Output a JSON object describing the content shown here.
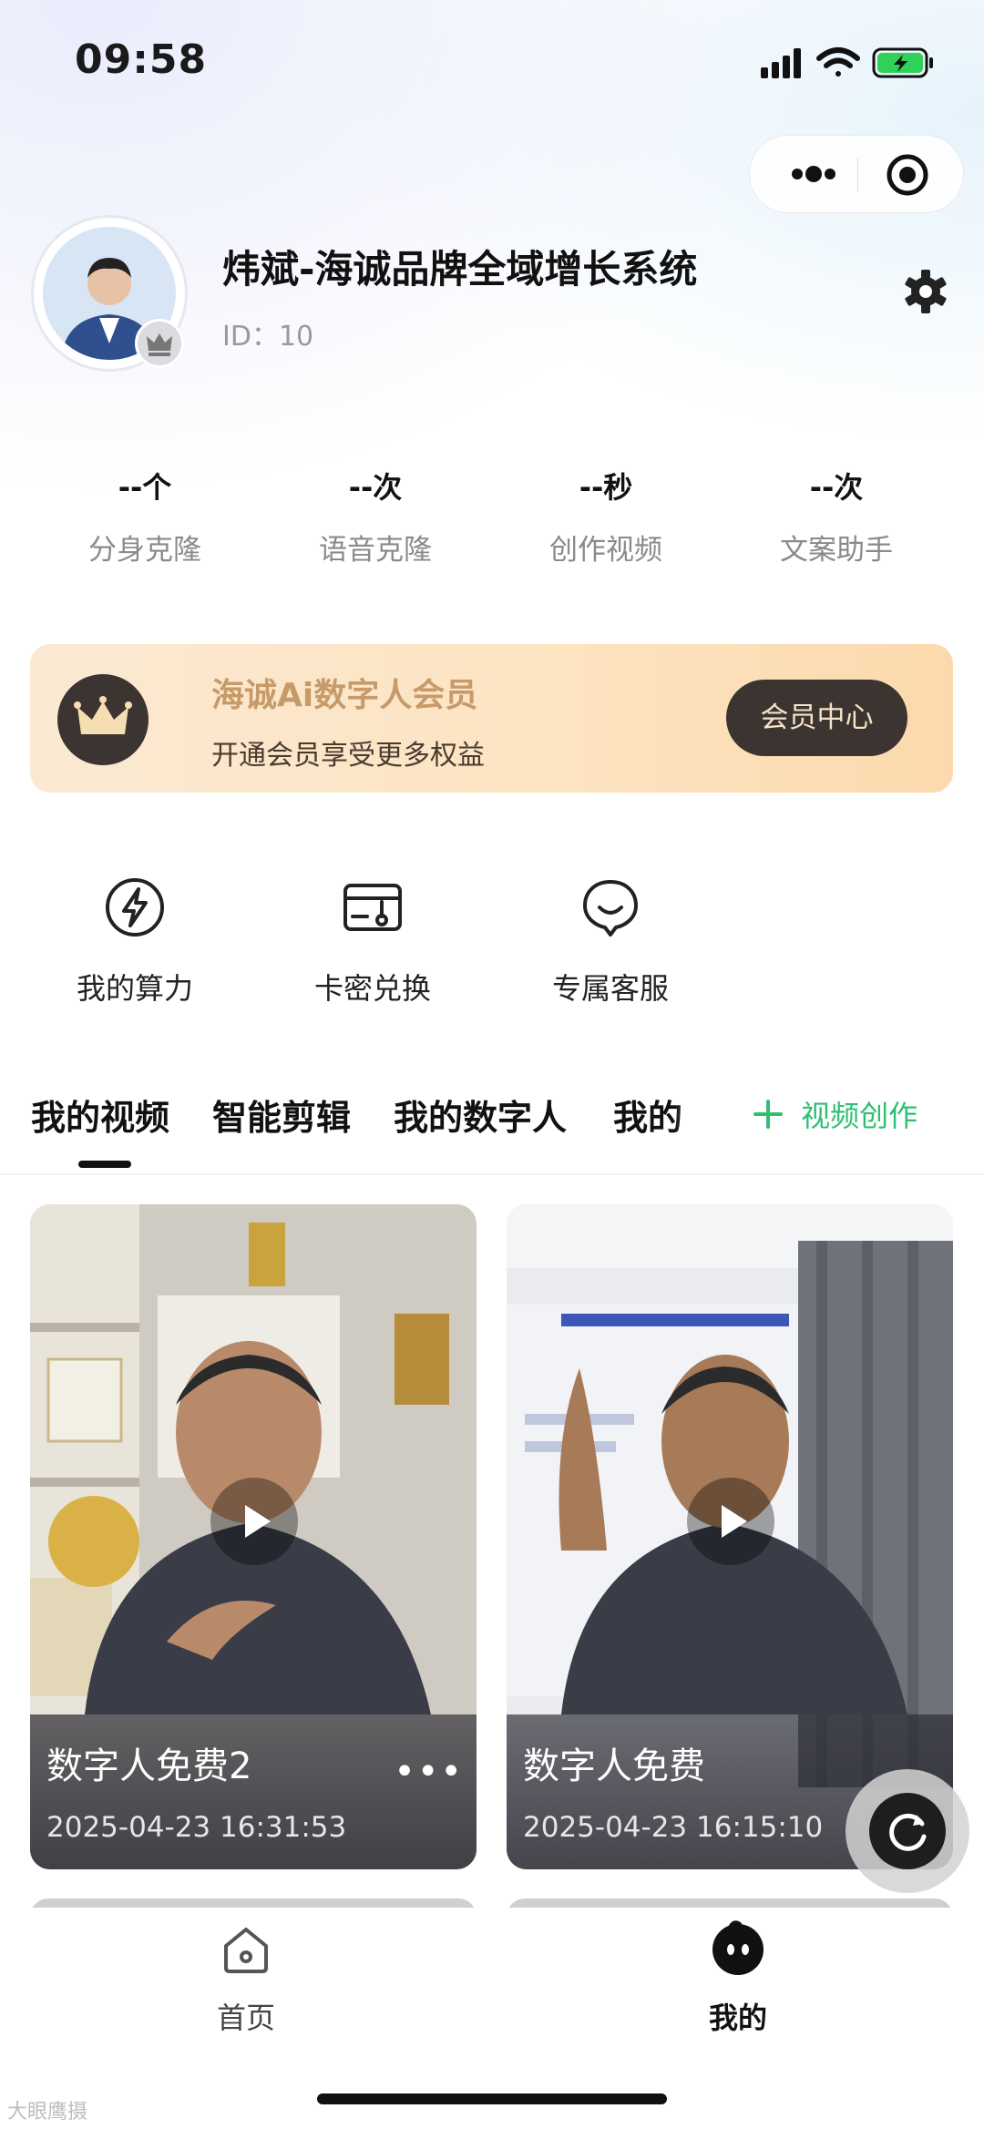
{
  "status_bar": {
    "time": "09:58"
  },
  "profile": {
    "name": "炜斌-海诚品牌全域增长系统",
    "id_text": "ID：10"
  },
  "stats": [
    {
      "value": "--个",
      "label": "分身克隆"
    },
    {
      "value": "--次",
      "label": "语音克隆"
    },
    {
      "value": "--秒",
      "label": "创作视频"
    },
    {
      "value": "--次",
      "label": "文案助手"
    }
  ],
  "member": {
    "title": "海诚Ai数字人会员",
    "subtitle": "开通会员享受更多权益",
    "button_label": "会员中心"
  },
  "quick_actions": [
    {
      "label": "我的算力",
      "icon": "lightning-icon"
    },
    {
      "label": "卡密兑换",
      "icon": "card-key-icon"
    },
    {
      "label": "专属客服",
      "icon": "customer-service-icon"
    }
  ],
  "tabs": [
    {
      "label": "我的视频",
      "active": true
    },
    {
      "label": "智能剪辑"
    },
    {
      "label": "我的数字人"
    },
    {
      "label": "我的"
    }
  ],
  "create_button": {
    "icon": "plus-icon",
    "label": "视频创作"
  },
  "videos": [
    {
      "title": "数字人免费2",
      "date": "2025-04-23 16:31:53",
      "more": "•••"
    },
    {
      "title": "数字人免费",
      "date": "2025-04-23 16:15:10"
    }
  ],
  "bottom_nav": [
    {
      "label": "首页",
      "icon": "home-icon",
      "active": false
    },
    {
      "label": "我的",
      "icon": "mine-icon",
      "active": true
    }
  ],
  "watermark": "大眼鹰摄",
  "colors": {
    "accent_green": "#2fbf71",
    "member_dark": "#3c3430",
    "member_gold": "#c79a6a"
  }
}
